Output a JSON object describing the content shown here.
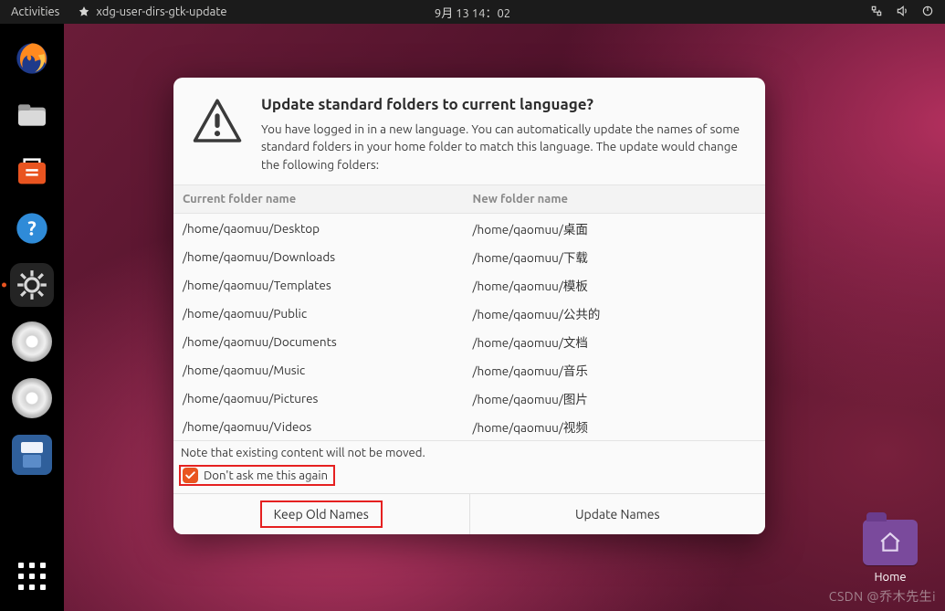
{
  "topbar": {
    "activities": "Activities",
    "app_menu": "xdg-user-dirs-gtk-update",
    "clock": "9月 13  14：02"
  },
  "dock": {
    "items": [
      {
        "name": "firefox"
      },
      {
        "name": "files"
      },
      {
        "name": "software"
      },
      {
        "name": "help"
      },
      {
        "name": "settings",
        "active": true
      },
      {
        "name": "disc-1"
      },
      {
        "name": "disc-2"
      },
      {
        "name": "save"
      }
    ]
  },
  "desktop": {
    "home_label": "Home"
  },
  "dialog": {
    "title": "Update standard folders to current language?",
    "message": "You have logged in in a new language. You can automatically update the names of some standard folders in your home folder to match this language. The update would change the following folders:",
    "columns": {
      "current": "Current folder name",
      "new": "New folder name"
    },
    "rows": [
      {
        "current": "/home/qaomuu/Desktop",
        "new": "/home/qaomuu/桌面"
      },
      {
        "current": "/home/qaomuu/Downloads",
        "new": "/home/qaomuu/下载"
      },
      {
        "current": "/home/qaomuu/Templates",
        "new": "/home/qaomuu/模板"
      },
      {
        "current": "/home/qaomuu/Public",
        "new": "/home/qaomuu/公共的"
      },
      {
        "current": "/home/qaomuu/Documents",
        "new": "/home/qaomuu/文档"
      },
      {
        "current": "/home/qaomuu/Music",
        "new": "/home/qaomuu/音乐"
      },
      {
        "current": "/home/qaomuu/Pictures",
        "new": "/home/qaomuu/图片"
      },
      {
        "current": "/home/qaomuu/Videos",
        "new": "/home/qaomuu/视频"
      }
    ],
    "note": "Note that existing content will not be moved.",
    "checkbox_label": "Don't ask me this again",
    "checkbox_checked": true,
    "buttons": {
      "keep": "Keep Old Names",
      "update": "Update Names"
    }
  },
  "watermark": "CSDN @乔木先生i"
}
